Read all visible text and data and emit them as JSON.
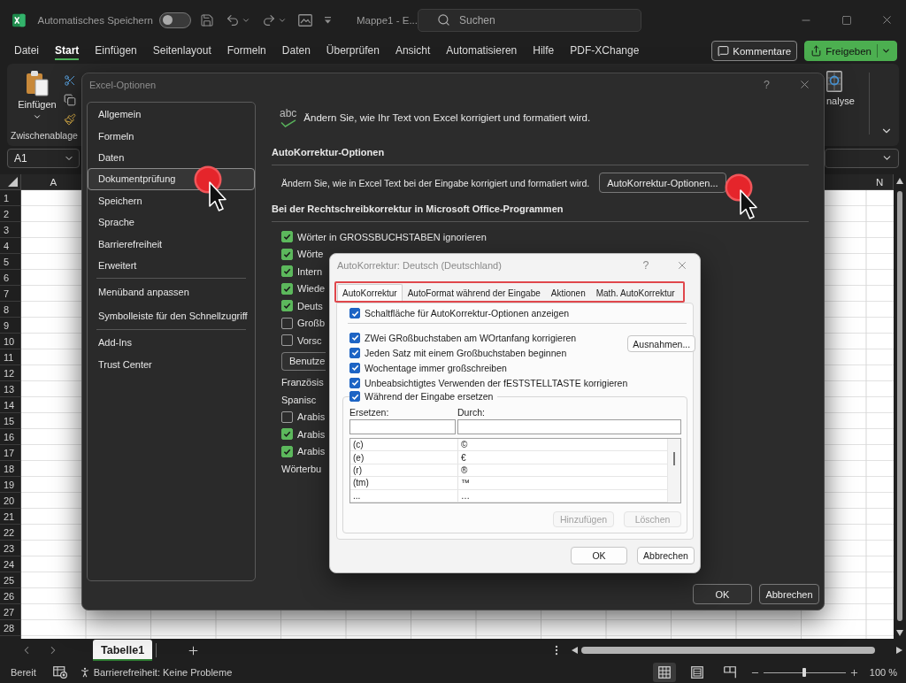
{
  "title_bar": {
    "autosave": {
      "label": "Automatisches Speichern",
      "on": false
    },
    "document_title": "Mappe1 - E...",
    "search": {
      "placeholder": "Suchen"
    }
  },
  "menu_tabs": [
    {
      "label": "Datei",
      "selected": false
    },
    {
      "label": "Start",
      "selected": true
    },
    {
      "label": "Einfügen",
      "selected": false
    },
    {
      "label": "Seitenlayout",
      "selected": false
    },
    {
      "label": "Formeln",
      "selected": false
    },
    {
      "label": "Daten",
      "selected": false
    },
    {
      "label": "Überprüfen",
      "selected": false
    },
    {
      "label": "Ansicht",
      "selected": false
    },
    {
      "label": "Automatisieren",
      "selected": false
    },
    {
      "label": "Hilfe",
      "selected": false
    },
    {
      "label": "PDF-XChange",
      "selected": false
    }
  ],
  "header_buttons": [
    {
      "kind": "comments",
      "label": "Kommentare"
    },
    {
      "kind": "share",
      "label": "Freigeben"
    }
  ],
  "ribbon": {
    "paste_label": "Einfügen",
    "clipboard_group_label": "Zwischenablage",
    "cut_off_button_label": "nalyse"
  },
  "formula_bar": {
    "name_box": "A1"
  },
  "grid": {
    "column_headers": [
      "A",
      "N"
    ],
    "row_numbers": [
      "1",
      "2",
      "3",
      "4",
      "5",
      "6",
      "7",
      "8",
      "9",
      "10",
      "11",
      "12",
      "13",
      "14",
      "15",
      "16",
      "17",
      "18",
      "19",
      "20",
      "21",
      "22",
      "23",
      "24",
      "25",
      "26",
      "27",
      "28"
    ]
  },
  "sheet_tabs": [
    {
      "label": "Tabelle1",
      "selected": true
    }
  ],
  "status_bar": {
    "mode": "Bereit",
    "accessibility": "Barrierefreiheit: Keine Probleme",
    "views": [
      {
        "kind": "normal",
        "selected": true
      },
      {
        "kind": "page_layout",
        "selected": false
      },
      {
        "kind": "page_break",
        "selected": false
      }
    ],
    "zoom": {
      "level": 0.5,
      "reading": "100 %"
    }
  },
  "options_dialog": {
    "title": "Excel-Optionen",
    "help": "?",
    "nav_sections": [
      {
        "items": [
          {
            "label": "Allgemein",
            "selected": false
          },
          {
            "label": "Formeln",
            "selected": false
          },
          {
            "label": "Daten",
            "selected": false
          },
          {
            "label": "Dokumentprüfung",
            "selected": true
          },
          {
            "label": "Speichern",
            "selected": false
          },
          {
            "label": "Sprache",
            "selected": false
          },
          {
            "label": "Barrierefreiheit",
            "selected": false
          },
          {
            "label": "Erweitert",
            "selected": false
          }
        ]
      },
      {
        "items": [
          {
            "label": "Menüband anpassen",
            "selected": false
          },
          {
            "label": "Symbolleiste für den Schnellzugriff",
            "selected": false
          }
        ]
      },
      {
        "items": [
          {
            "label": "Add-Ins",
            "selected": false
          },
          {
            "label": "Trust Center",
            "selected": false
          }
        ]
      }
    ],
    "intro": {
      "icon_label": "abc",
      "text": "Ändern Sie, wie Ihr Text von Excel korrigiert und formatiert wird."
    },
    "autocorrect_section": {
      "heading": "AutoKorrektur-Optionen",
      "description": "Ändern Sie, wie in Excel Text bei der Eingabe korrigiert und formatiert wird.",
      "button": "AutoKorrektur-Optionen..."
    },
    "spelling_section": {
      "heading": "Bei der Rechtschreibkorrektur in Microsoft Office-Programmen",
      "items": [
        {
          "kind": "checkbox",
          "label": "Wörter in GROSSBUCHSTABEN ignorieren",
          "checked": true
        },
        {
          "kind": "checkbox",
          "label": "Wörte",
          "checked": true
        },
        {
          "kind": "checkbox",
          "label": "Intern",
          "checked": true
        },
        {
          "kind": "checkbox",
          "label": "Wiede",
          "checked": true
        },
        {
          "kind": "checkbox",
          "label": "Deuts",
          "checked": true
        },
        {
          "kind": "checkbox",
          "label": "Großb",
          "checked": false
        },
        {
          "kind": "checkbox",
          "label": "Vorsc",
          "checked": false
        },
        {
          "kind": "button",
          "label": "Benutze"
        },
        {
          "kind": "label",
          "label": "Französis"
        },
        {
          "kind": "label",
          "label": "Spanisc"
        },
        {
          "kind": "checkbox",
          "label": "Arabis",
          "checked": false
        },
        {
          "kind": "checkbox",
          "label": "Arabis",
          "checked": true
        },
        {
          "kind": "checkbox",
          "label": "Arabis",
          "checked": true
        },
        {
          "kind": "label",
          "label": "Wörterbu"
        }
      ]
    },
    "buttons": [
      "OK",
      "Abbrechen"
    ]
  },
  "autocorrect_dialog": {
    "title": "AutoKorrektur: Deutsch (Deutschland)",
    "help": "?",
    "tabs": [
      {
        "label": "AutoKorrektur",
        "selected": true
      },
      {
        "label": "AutoFormat während der Eingabe",
        "selected": false
      },
      {
        "label": "Aktionen",
        "selected": false
      },
      {
        "label": "Math. AutoKorrektur",
        "selected": false
      }
    ],
    "show_options_button": {
      "label": "Schaltfläche für AutoKorrektur-Optionen anzeigen",
      "checked": true
    },
    "options": [
      {
        "label": "ZWei GRoßbuchstaben am WOrtanfang korrigieren",
        "checked": true
      },
      {
        "label": "Jeden Satz mit einem Großbuchstaben beginnen",
        "checked": true
      },
      {
        "label": "Wochentage immer großschreiben",
        "checked": true
      },
      {
        "label": "Unbeabsichtigtes Verwenden der fESTSTELLTASTE korrigieren",
        "checked": true
      }
    ],
    "exceptions_button": "Ausnahmen...",
    "replace_group": {
      "replace_while_typing": {
        "label": "Während der Eingabe ersetzen",
        "checked": true
      },
      "replace_label": "Ersetzen:",
      "with_label": "Durch:",
      "entries": [
        {
          "replace": "(c)",
          "with": "©"
        },
        {
          "replace": "(e)",
          "with": "€"
        },
        {
          "replace": "(r)",
          "with": "®"
        },
        {
          "replace": "(tm)",
          "with": "™"
        },
        {
          "replace": "...",
          "with": "…"
        }
      ],
      "add_button": {
        "label": "Hinzufügen",
        "disabled": true
      },
      "delete_button": {
        "label": "Löschen",
        "disabled": true
      }
    },
    "buttons": [
      "OK",
      "Abbrechen"
    ]
  }
}
